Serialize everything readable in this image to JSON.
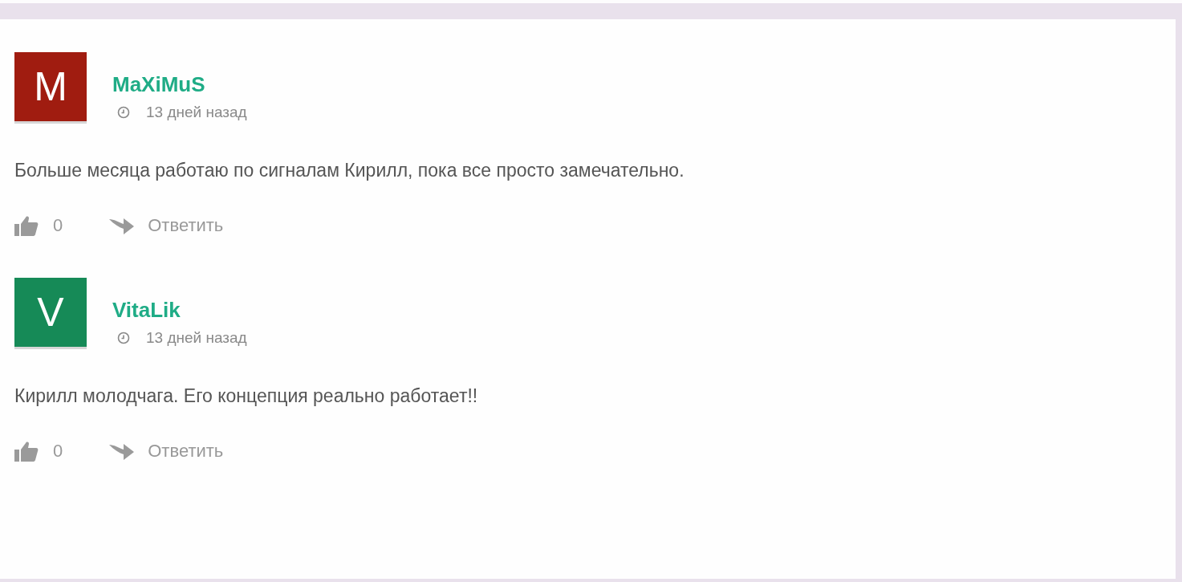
{
  "comments": [
    {
      "avatar_letter": "M",
      "color": "#a01c10",
      "author": "MaXiMuS",
      "time": "13 дней назад",
      "text": "Больше месяца работаю по сигналам Кирилл, пока все просто замечательно.",
      "likes": "0",
      "reply": "Ответить"
    },
    {
      "avatar_letter": "V",
      "color": "#168a57",
      "author": "VitaLik",
      "time": "13 дней назад",
      "text": "Кирилл молодчага. Его концепция реально работает!!",
      "likes": "0",
      "reply": "Ответить"
    }
  ]
}
